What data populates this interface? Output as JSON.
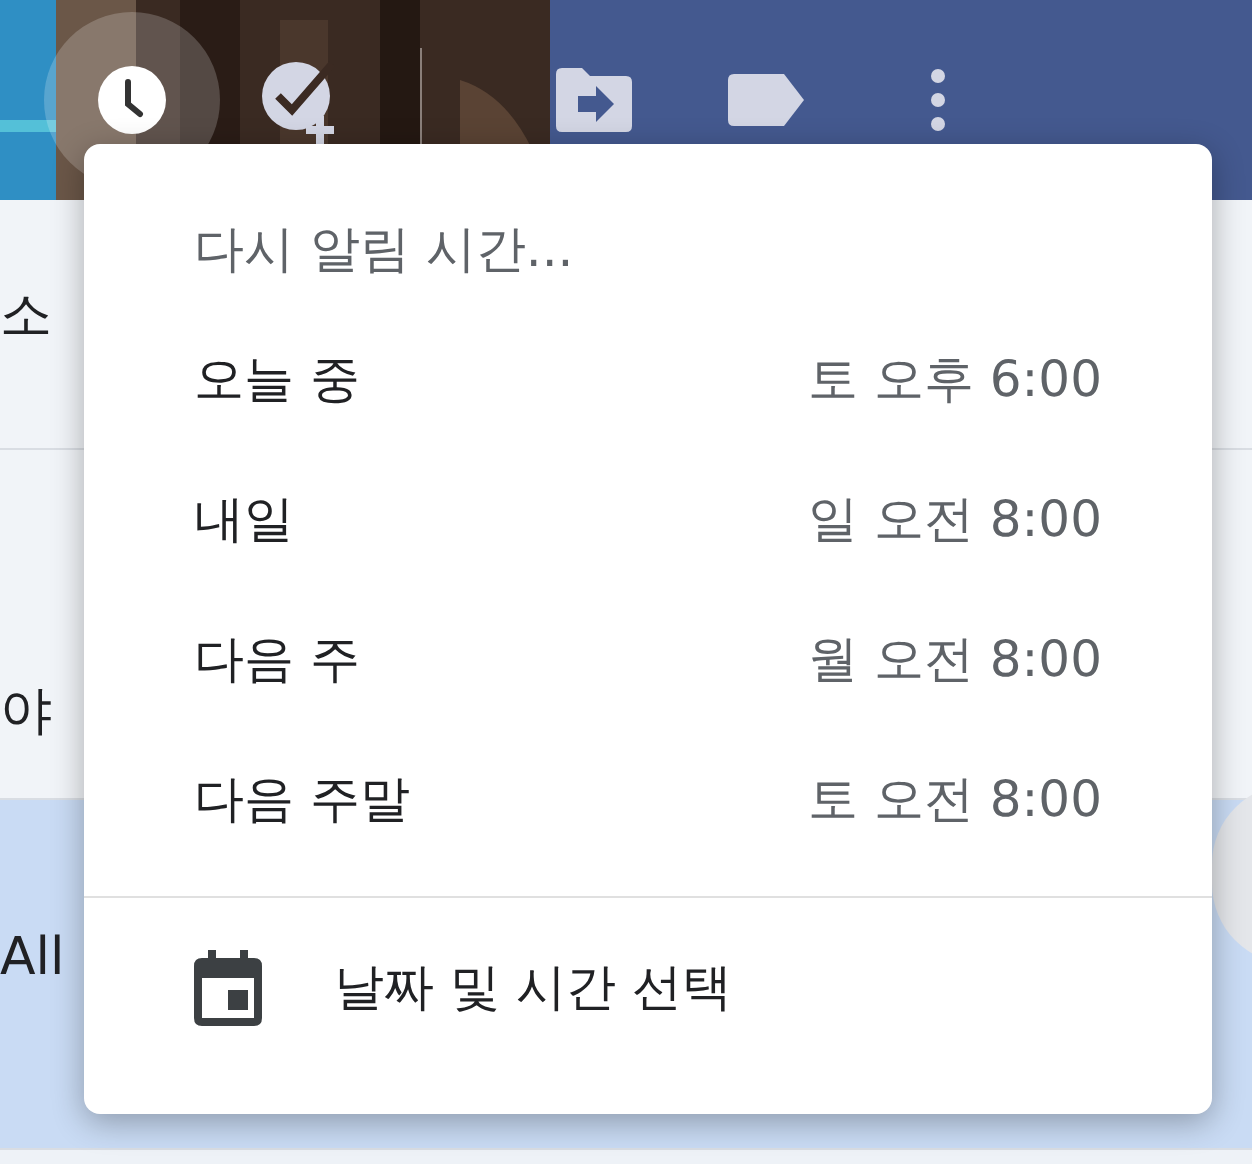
{
  "toolbar": [
    {
      "kind": "snooze",
      "selected": true
    },
    {
      "kind": "add_task",
      "selected": false
    },
    {
      "kind": "move",
      "selected": false
    },
    {
      "kind": "label",
      "selected": false
    },
    {
      "kind": "more",
      "selected": false
    }
  ],
  "list": [
    {
      "text": "소",
      "selected": false
    },
    {
      "text": "야",
      "selected": false
    },
    {
      "text": "All",
      "selected": true
    }
  ],
  "snooze_menu": {
    "title": "다시 알림 시간...",
    "options": [
      {
        "label": "오늘 중",
        "time": "토 오후 6:00"
      },
      {
        "label": "내일",
        "time": "일 오전 8:00"
      },
      {
        "label": "다음 주",
        "time": "월 오전 8:00"
      },
      {
        "label": "다음 주말",
        "time": "토 오전 8:00"
      }
    ],
    "custom": {
      "label": "날짜 및 시간 선택"
    }
  }
}
